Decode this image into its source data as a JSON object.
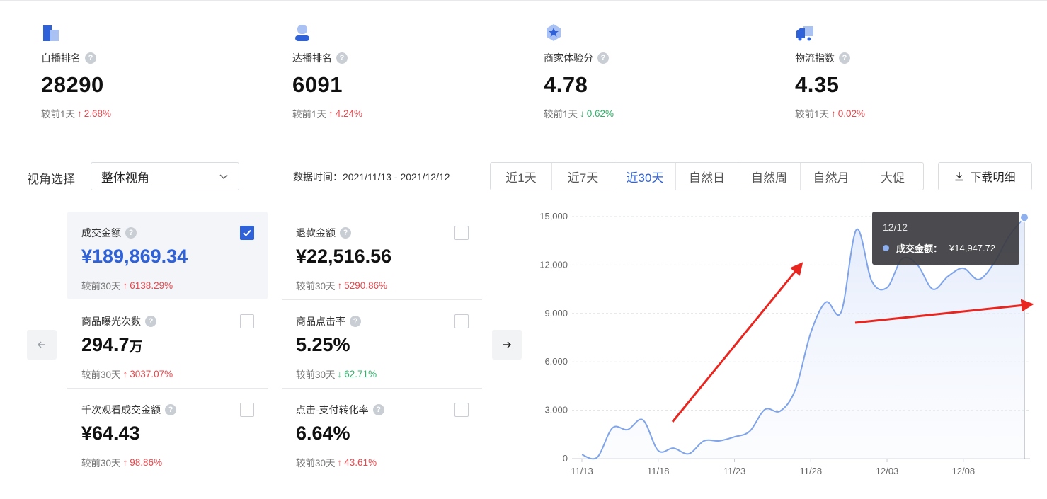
{
  "kpis": [
    {
      "label": "自播排名",
      "value": "28290",
      "compare_label": "较前1天",
      "direction": "up",
      "arrow": "↑",
      "change": "2.68%",
      "icon": "building-icon"
    },
    {
      "label": "达播排名",
      "value": "6091",
      "compare_label": "较前1天",
      "direction": "up",
      "arrow": "↑",
      "change": "4.24%",
      "icon": "person-icon"
    },
    {
      "label": "商家体验分",
      "value": "4.78",
      "compare_label": "较前1天",
      "direction": "down",
      "arrow": "↓",
      "change": "0.62%",
      "icon": "star-badge-icon"
    },
    {
      "label": "物流指数",
      "value": "4.35",
      "compare_label": "较前1天",
      "direction": "up",
      "arrow": "↑",
      "change": "0.02%",
      "icon": "truck-icon"
    }
  ],
  "filters": {
    "view_label": "视角选择",
    "view_value": "整体视角",
    "date_range": "数据时间：2021/11/13 - 2021/12/12",
    "periods": [
      "近1天",
      "近7天",
      "近30天",
      "自然日",
      "自然周",
      "自然月",
      "大促"
    ],
    "active_period": "近30天",
    "download_label": "下载明细"
  },
  "metrics": [
    {
      "label": "成交金额",
      "value": "¥189,869.34",
      "unit": "",
      "compare_label": "较前30天",
      "direction": "up",
      "arrow": "↑",
      "change": "6138.29%",
      "checked": true
    },
    {
      "label": "退款金额",
      "value": "¥22,516.56",
      "unit": "",
      "compare_label": "较前30天",
      "direction": "up",
      "arrow": "↑",
      "change": "5290.86%",
      "checked": false
    },
    {
      "label": "商品曝光次数",
      "value": "294.7",
      "unit": "万",
      "compare_label": "较前30天",
      "direction": "up",
      "arrow": "↑",
      "change": "3037.07%",
      "checked": false
    },
    {
      "label": "商品点击率",
      "value": "5.25%",
      "unit": "",
      "compare_label": "较前30天",
      "direction": "down",
      "arrow": "↓",
      "change": "62.71%",
      "checked": false
    },
    {
      "label": "千次观看成交金额",
      "value": "¥64.43",
      "unit": "",
      "compare_label": "较前30天",
      "direction": "up",
      "arrow": "↑",
      "change": "98.86%",
      "checked": false
    },
    {
      "label": "点击-支付转化率",
      "value": "6.64%",
      "unit": "",
      "compare_label": "较前30天",
      "direction": "up",
      "arrow": "↑",
      "change": "43.61%",
      "checked": false
    }
  ],
  "tooltip": {
    "date": "12/12",
    "series_name": "成交金额：",
    "value": "¥14,947.72"
  },
  "colors": {
    "accent": "#2f62d8",
    "up": "#e5484d",
    "down": "#2fb26a",
    "line": "#7fa4ea",
    "annotation": "#e8251f"
  },
  "chart_data": {
    "type": "area",
    "x": [
      "11/13",
      "11/14",
      "11/15",
      "11/16",
      "11/17",
      "11/18",
      "11/19",
      "11/20",
      "11/21",
      "11/22",
      "11/23",
      "11/24",
      "11/25",
      "11/26",
      "11/27",
      "11/28",
      "11/29",
      "11/30",
      "12/01",
      "12/02",
      "12/03",
      "12/04",
      "12/05",
      "12/06",
      "12/07",
      "12/08",
      "12/09",
      "12/10",
      "12/11",
      "12/12"
    ],
    "series": [
      {
        "name": "成交金额",
        "values": [
          250,
          80,
          1900,
          1800,
          2400,
          500,
          650,
          300,
          1100,
          1100,
          1350,
          1700,
          3050,
          2950,
          4300,
          7800,
          9700,
          9100,
          14200,
          11000,
          10600,
          12400,
          12000,
          10500,
          11300,
          11800,
          11100,
          12100,
          13800,
          14947.72
        ]
      }
    ],
    "xticks": [
      "11/13",
      "11/18",
      "11/23",
      "11/28",
      "12/03",
      "12/08"
    ],
    "yticks": [
      "0",
      "3,000",
      "6,000",
      "9,000",
      "12,000",
      "15,000"
    ],
    "ylim": [
      0,
      15000
    ],
    "grid": true,
    "highlighted_point": "12/12"
  }
}
